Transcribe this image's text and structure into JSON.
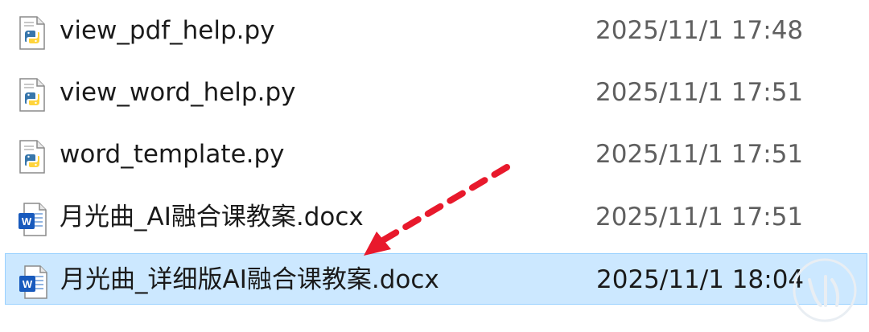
{
  "files": [
    {
      "name": "view_pdf_help.py",
      "date": "2025/11/1 17:48",
      "icon": "python-file-icon",
      "selected": false
    },
    {
      "name": "view_word_help.py",
      "date": "2025/11/1 17:51",
      "icon": "python-file-icon",
      "selected": false
    },
    {
      "name": "word_template.py",
      "date": "2025/11/1 17:51",
      "icon": "python-file-icon",
      "selected": false
    },
    {
      "name": "月光曲_AI融合课教案.docx",
      "date": "2025/11/1 17:51",
      "icon": "word-file-icon",
      "selected": false
    },
    {
      "name": "月光曲_详细版AI融合课教案.docx",
      "date": "2025/11/1 18:04",
      "icon": "word-file-icon",
      "selected": true
    }
  ],
  "colors": {
    "selection_background": "#cce8ff",
    "selection_border": "#99d1ff",
    "arrow": "#e8192c",
    "word_blue": "#185abd",
    "python_blue": "#3776ab",
    "python_yellow": "#ffd43b"
  }
}
